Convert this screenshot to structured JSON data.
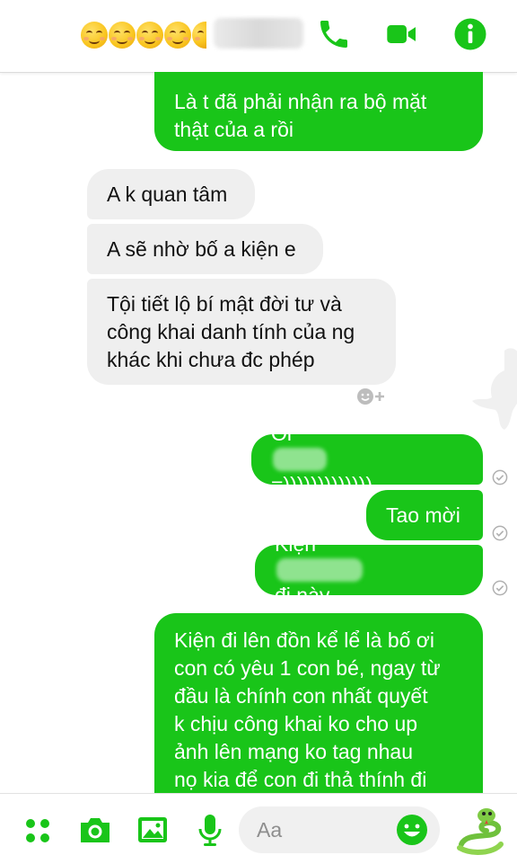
{
  "header": {
    "emoji_count": 5,
    "icons": [
      "phone-icon",
      "video-camera-icon",
      "info-icon"
    ],
    "accent_color": "#19c519"
  },
  "messages": [
    {
      "side": "sent",
      "lines": [
        "Là t đã phải nhận ra bộ mặt",
        "thật của a rồi"
      ]
    },
    {
      "side": "received",
      "lines": [
        "A k quan tâm"
      ]
    },
    {
      "side": "received",
      "lines": [
        "A sẽ nhờ bố a kiện e"
      ]
    },
    {
      "side": "received",
      "lines": [
        "Tội tiết lộ bí mật đời tư và",
        "công khai danh tính của ng",
        "khác khi chưa đc phép"
      ]
    },
    {
      "side": "sent",
      "prefix": "Ôi",
      "suffix": "=)))))))))))))"
    },
    {
      "side": "sent",
      "lines": [
        "Tao mời"
      ]
    },
    {
      "side": "sent",
      "prefix": "Kiện",
      "suffix": "đi này"
    },
    {
      "side": "sent",
      "lines": [
        "Kiện đi lên đồn kể lể là bố ơi",
        "con có yêu 1 con bé, ngay từ",
        "đầu là chính con nhất quyết",
        "k chịu công khai ko cho up",
        "ảnh lên mạng ko tag nhau",
        "nọ kia để con đi thả thính đi"
      ]
    }
  ],
  "composer": {
    "placeholder": "Aa",
    "icons": [
      "menu-dots-icon",
      "camera-icon",
      "image-icon",
      "microphone-icon",
      "emoji-icon",
      "snake-sticker-icon"
    ]
  },
  "colors": {
    "sent_bubble": "#19c519",
    "received_bubble": "#efefef",
    "icon_green": "#19c519"
  }
}
